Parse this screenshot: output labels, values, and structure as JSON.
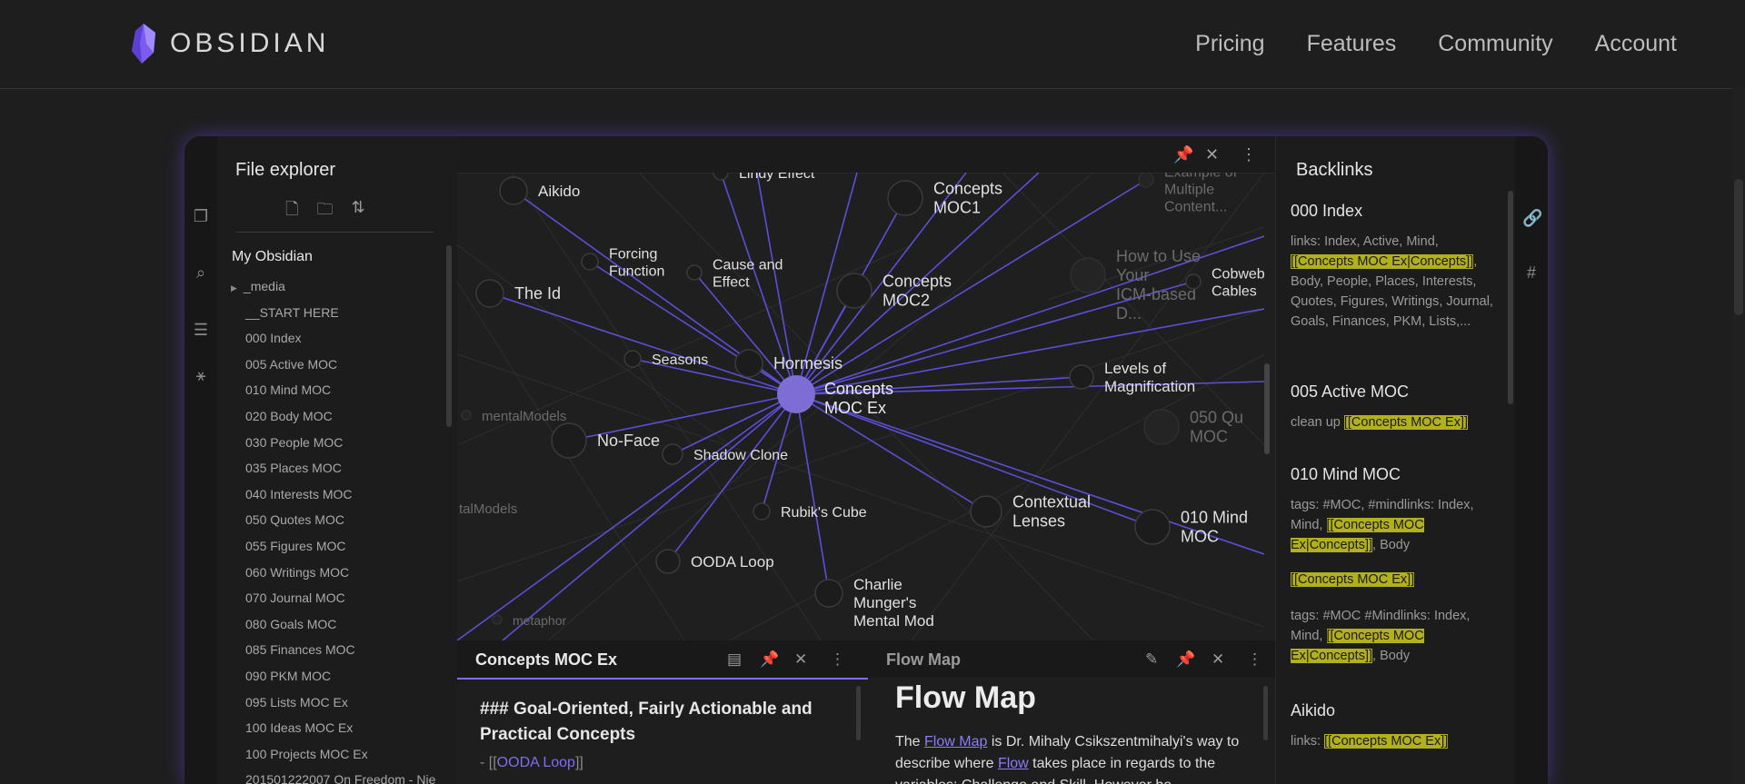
{
  "header": {
    "brand": "OBSIDIAN",
    "nav": [
      "Pricing",
      "Features",
      "Community",
      "Account"
    ]
  },
  "explorer": {
    "title": "File explorer",
    "vault": "My Obsidian",
    "items": [
      "_media",
      "__START HERE",
      "000 Index",
      "005 Active MOC",
      "010 Mind MOC",
      "020 Body MOC",
      "030 People MOC",
      "035 Places MOC",
      "040 Interests MOC",
      "050 Quotes MOC",
      "055 Figures MOC",
      "060 Writings MOC",
      "070 Journal MOC",
      "080 Goals MOC",
      "085 Finances MOC",
      "090 PKM MOC",
      "095 Lists MOC Ex",
      "100 Ideas MOC Ex",
      "100 Projects MOC Ex",
      "201501222007 On Freedom - Nie"
    ]
  },
  "graph": {
    "center": "Concepts MOC Ex",
    "nodes": [
      {
        "id": "lindy",
        "lines": [
          "Lindy Effect"
        ]
      },
      {
        "id": "aikido",
        "lines": [
          "Aikido"
        ]
      },
      {
        "id": "moc1",
        "lines": [
          "Concepts",
          "MOC1"
        ]
      },
      {
        "id": "example",
        "lines": [
          "Example of",
          "Multiple",
          "Content..."
        ]
      },
      {
        "id": "forcing",
        "lines": [
          "Forcing",
          "Function"
        ]
      },
      {
        "id": "cause",
        "lines": [
          "Cause and",
          "Effect"
        ]
      },
      {
        "id": "theid",
        "lines": [
          "The Id"
        ]
      },
      {
        "id": "moc2",
        "lines": [
          "Concepts",
          "MOC2"
        ]
      },
      {
        "id": "howto",
        "lines": [
          "How to Use",
          "Your",
          "ICM-based",
          "D..."
        ]
      },
      {
        "id": "cobweb",
        "lines": [
          "Cobweb",
          "Cables"
        ]
      },
      {
        "id": "seasons",
        "lines": [
          "Seasons"
        ]
      },
      {
        "id": "hormesis",
        "lines": [
          "Hormesis"
        ]
      },
      {
        "id": "levels",
        "lines": [
          "Levels of",
          "Magnification"
        ]
      },
      {
        "id": "mental",
        "lines": [
          "mentalModels"
        ]
      },
      {
        "id": "quotes",
        "lines": [
          "050 Qu",
          "MOC"
        ]
      },
      {
        "id": "noface",
        "lines": [
          "No-Face"
        ]
      },
      {
        "id": "shadow",
        "lines": [
          "Shadow Clone"
        ]
      },
      {
        "id": "talmodels",
        "lines": [
          "talModels"
        ]
      },
      {
        "id": "rubik",
        "lines": [
          "Rubik's Cube"
        ]
      },
      {
        "id": "contextual",
        "lines": [
          "Contextual",
          "Lenses"
        ]
      },
      {
        "id": "mind",
        "lines": [
          "010 Mind",
          "MOC"
        ]
      },
      {
        "id": "ooda",
        "lines": [
          "OODA Loop"
        ]
      },
      {
        "id": "charlie",
        "lines": [
          "Charlie",
          "Munger's",
          "Mental Mod"
        ]
      },
      {
        "id": "metaphor",
        "lines": [
          "metaphor"
        ]
      }
    ]
  },
  "note_left": {
    "tab": "Concepts MOC Ex",
    "heading": "### Goal-Oriented, Fairly Actionable and Practical Concepts",
    "list_prefix": "- [[",
    "list_link": "OODA Loop",
    "list_suffix": "]]"
  },
  "note_right": {
    "tab": "Flow Map",
    "title": "Flow Map",
    "p_1": "The ",
    "p_link1": "Flow Map",
    "p_2": " is Dr. Mihaly Csikszentmihalyi's way to describe where ",
    "p_link2": "Flow",
    "p_3": " takes place in regards to the variables: Challenge and Skill. However he"
  },
  "backlinks": {
    "title": "Backlinks",
    "entries": [
      {
        "title": "000 Index",
        "pre": "links: Index, Active, Mind, ",
        "hl": "[[Concepts MOC Ex|Concepts]]",
        "post": ", Body, People, Places, Interests, Quotes, Figures, Writings, Journal, Goals, Finances, PKM, Lists,..."
      },
      {
        "title": "005 Active MOC",
        "pre": "clean up ",
        "hl": "[[Concepts MOC Ex]]",
        "post": ""
      },
      {
        "title": "010 Mind MOC",
        "pre": "tags: #MOC, #mindlinks: Index, Mind, ",
        "hl": "[[Concepts MOC Ex|Concepts]]",
        "post": ", Body",
        "extra1": "[[Concepts MOC Ex]]",
        "pre2": "tags: #MOC #Mindlinks: Index, Mind, ",
        "hl2": "[[Concepts MOC Ex|Concepts]]",
        "post2": ", Body"
      },
      {
        "title": "Aikido",
        "pre": "links: ",
        "hl": "[[Concepts MOC Ex]]",
        "post": ""
      }
    ]
  },
  "colors": {
    "accent": "#7f6df2",
    "highlight": "#b2b01b",
    "edge": "#5a4fd6"
  }
}
